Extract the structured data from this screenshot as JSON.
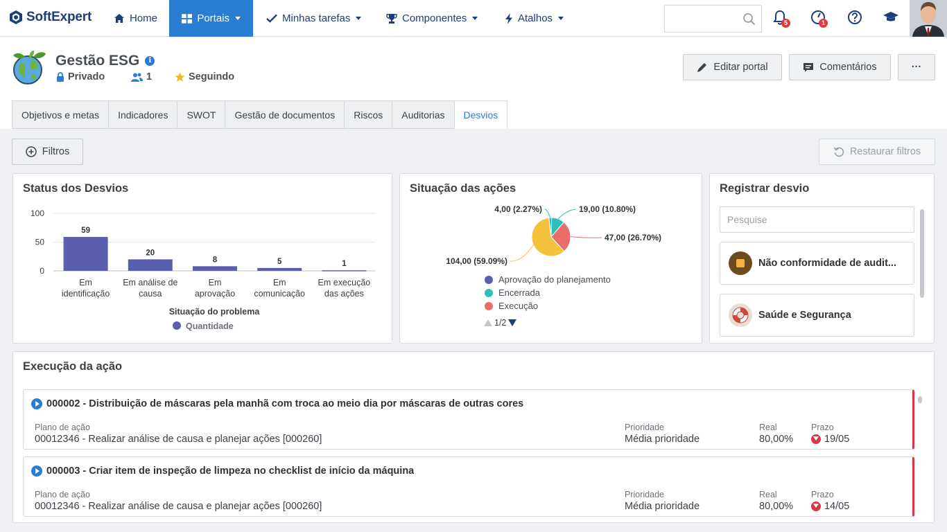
{
  "topbar": {
    "logo": "SoftExpert",
    "nav": {
      "home": "Home",
      "portais": "Portais",
      "tarefas": "Minhas tarefas",
      "componentes": "Componentes",
      "atalhos": "Atalhos"
    },
    "notifications_count": "5",
    "alerts_count": "1",
    "search_value": ""
  },
  "portal": {
    "title": "Gestão ESG",
    "privacy": "Privado",
    "members": "1",
    "following": "Seguindo",
    "edit_button": "Editar portal",
    "comments_button": "Comentários",
    "more_button": "···"
  },
  "tabs": [
    {
      "label": "Objetivos e metas"
    },
    {
      "label": "Indicadores"
    },
    {
      "label": "SWOT"
    },
    {
      "label": "Gestão de documentos"
    },
    {
      "label": "Riscos"
    },
    {
      "label": "Auditorias"
    },
    {
      "label": "Desvios",
      "active": true
    }
  ],
  "toolbar": {
    "filters": "Filtros",
    "restore": "Restaurar filtros"
  },
  "status_card": {
    "title": "Status dos Desvios"
  },
  "actions_card": {
    "title": "Situação das ações",
    "pager": "1/2"
  },
  "register_card": {
    "title": "Registrar desvio",
    "search_placeholder": "Pesquise",
    "items": [
      {
        "label": "Não conformidade de audit..."
      },
      {
        "label": "Saúde e Segurança"
      }
    ]
  },
  "execution_card": {
    "title": "Execução da ação",
    "items": [
      {
        "title": "000002 - Distribuição de máscaras pela manhã com troca ao meio dia por máscaras de outras cores",
        "plan_label": "Plano de ação",
        "plan_value": "00012346 - Realizar análise de causa e planejar ações [000260]",
        "priority_label": "Prioridade",
        "priority_value": "Média prioridade",
        "real_label": "Real",
        "real_value": "80,00%",
        "deadline_label": "Prazo",
        "deadline_value": "19/05"
      },
      {
        "title": "000003 - Criar item de inspeção de limpeza no checklist de início da máquina",
        "plan_label": "Plano de ação",
        "plan_value": "00012346 - Realizar análise de causa e planejar ações [000260]",
        "priority_label": "Prioridade",
        "priority_value": "Média prioridade",
        "real_label": "Real",
        "real_value": "80,00%",
        "deadline_label": "Prazo",
        "deadline_value": "14/05"
      }
    ]
  },
  "chart_data": [
    {
      "type": "bar",
      "categories": [
        "Em identificação",
        "Em análise de causa",
        "Em aprovação",
        "Em comunicação",
        "Em execução das ações"
      ],
      "category_lines": [
        [
          "Em",
          "identificação"
        ],
        [
          "Em análise de",
          "causa"
        ],
        [
          "Em",
          "aprovação"
        ],
        [
          "Em",
          "comunicação"
        ],
        [
          "Em execução",
          "das ações"
        ]
      ],
      "series": [
        {
          "name": "Quantidade",
          "values": [
            59,
            20,
            8,
            5,
            1
          ]
        }
      ],
      "xlabel": "Situação do problema",
      "ylabel": "",
      "ylim": [
        0,
        100
      ],
      "yticks": [
        0,
        50,
        100
      ],
      "grid": true,
      "legend": "bottom",
      "color": "#5b5fae"
    },
    {
      "type": "pie",
      "slices": [
        {
          "label": "Aprovação do planejamento",
          "value": 104.0,
          "display": "104,00 (59.09%)",
          "color": "#f5c23e"
        },
        {
          "label": "Encerrada",
          "value": 4.0,
          "display": "4,00 (2.27%)",
          "color": "#2fbfb7"
        },
        {
          "label": "Execução",
          "value": 19.0,
          "display": "19,00 (10.80%)",
          "color": "#2fbfb7"
        },
        {
          "label": "",
          "value": 47.0,
          "display": "47,00 (26.70%)",
          "color": "#ec6b6b"
        }
      ],
      "legend": [
        {
          "label": "Aprovação do planejamento",
          "color": "#5b5fae"
        },
        {
          "label": "Encerrada",
          "color": "#2fbfb7"
        },
        {
          "label": "Execução",
          "color": "#ec6b6b"
        }
      ],
      "legend_position": "bottom"
    }
  ]
}
